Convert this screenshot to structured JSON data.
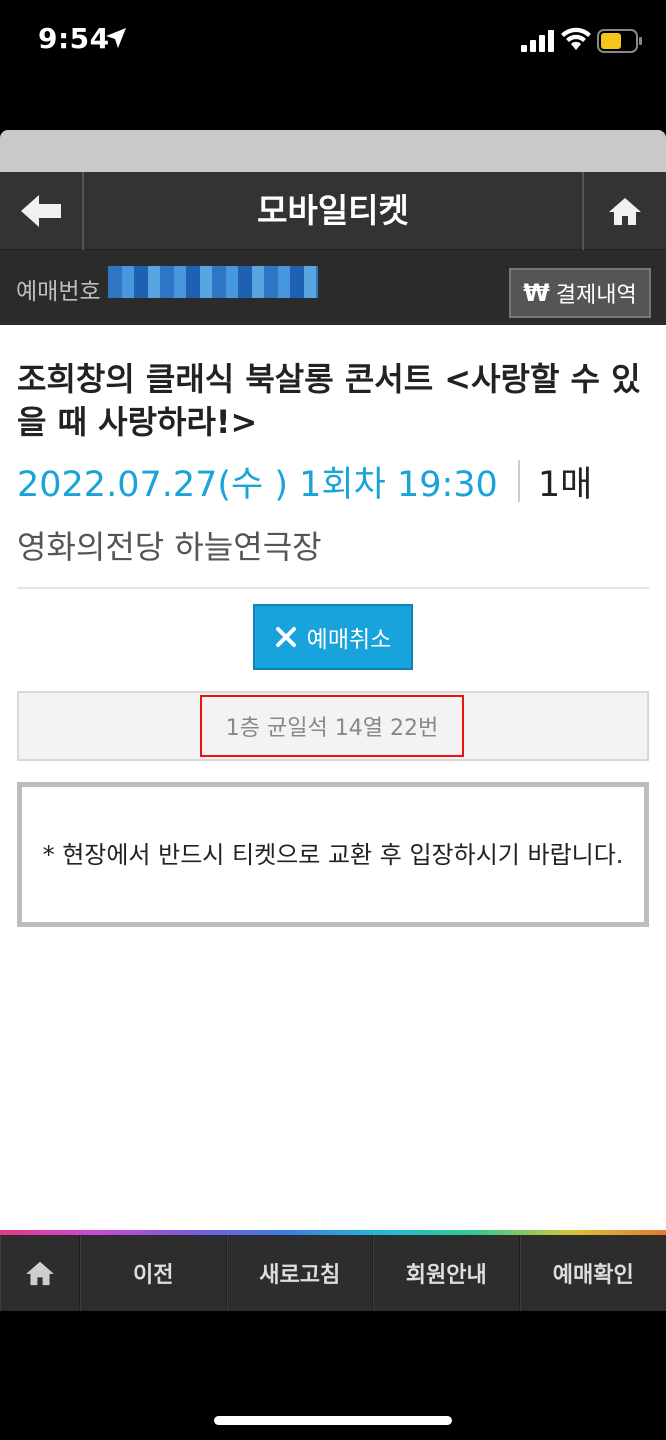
{
  "status_bar": {
    "time": "9:54"
  },
  "header": {
    "title": "모바일티켓"
  },
  "booking": {
    "label": "예매번호",
    "payment_label": "결제내역",
    "payment_icon": "₩"
  },
  "show": {
    "title": "조희창의 클래식 북살롱 콘서트 <사랑할 수 있을 때 사랑하라!>",
    "date": "2022.07.27(수 ) 1회차 19:30",
    "count": "1매",
    "venue": "영화의전당 하늘연극장"
  },
  "actions": {
    "cancel_label": "예매취소"
  },
  "seat": {
    "info": "1층 균일석 14열 22번",
    "highlight_color": "#e11111"
  },
  "notice": {
    "text": "* 현장에서 반드시 티켓으로 교환 후 입장하시기 바랍니다."
  },
  "bottom_nav": {
    "items": [
      {
        "label": "이전"
      },
      {
        "label": "새로고침"
      },
      {
        "label": "회원안내"
      },
      {
        "label": "예매확인"
      }
    ]
  },
  "colors": {
    "accent": "#18a3dc",
    "header_bg": "#333333"
  }
}
